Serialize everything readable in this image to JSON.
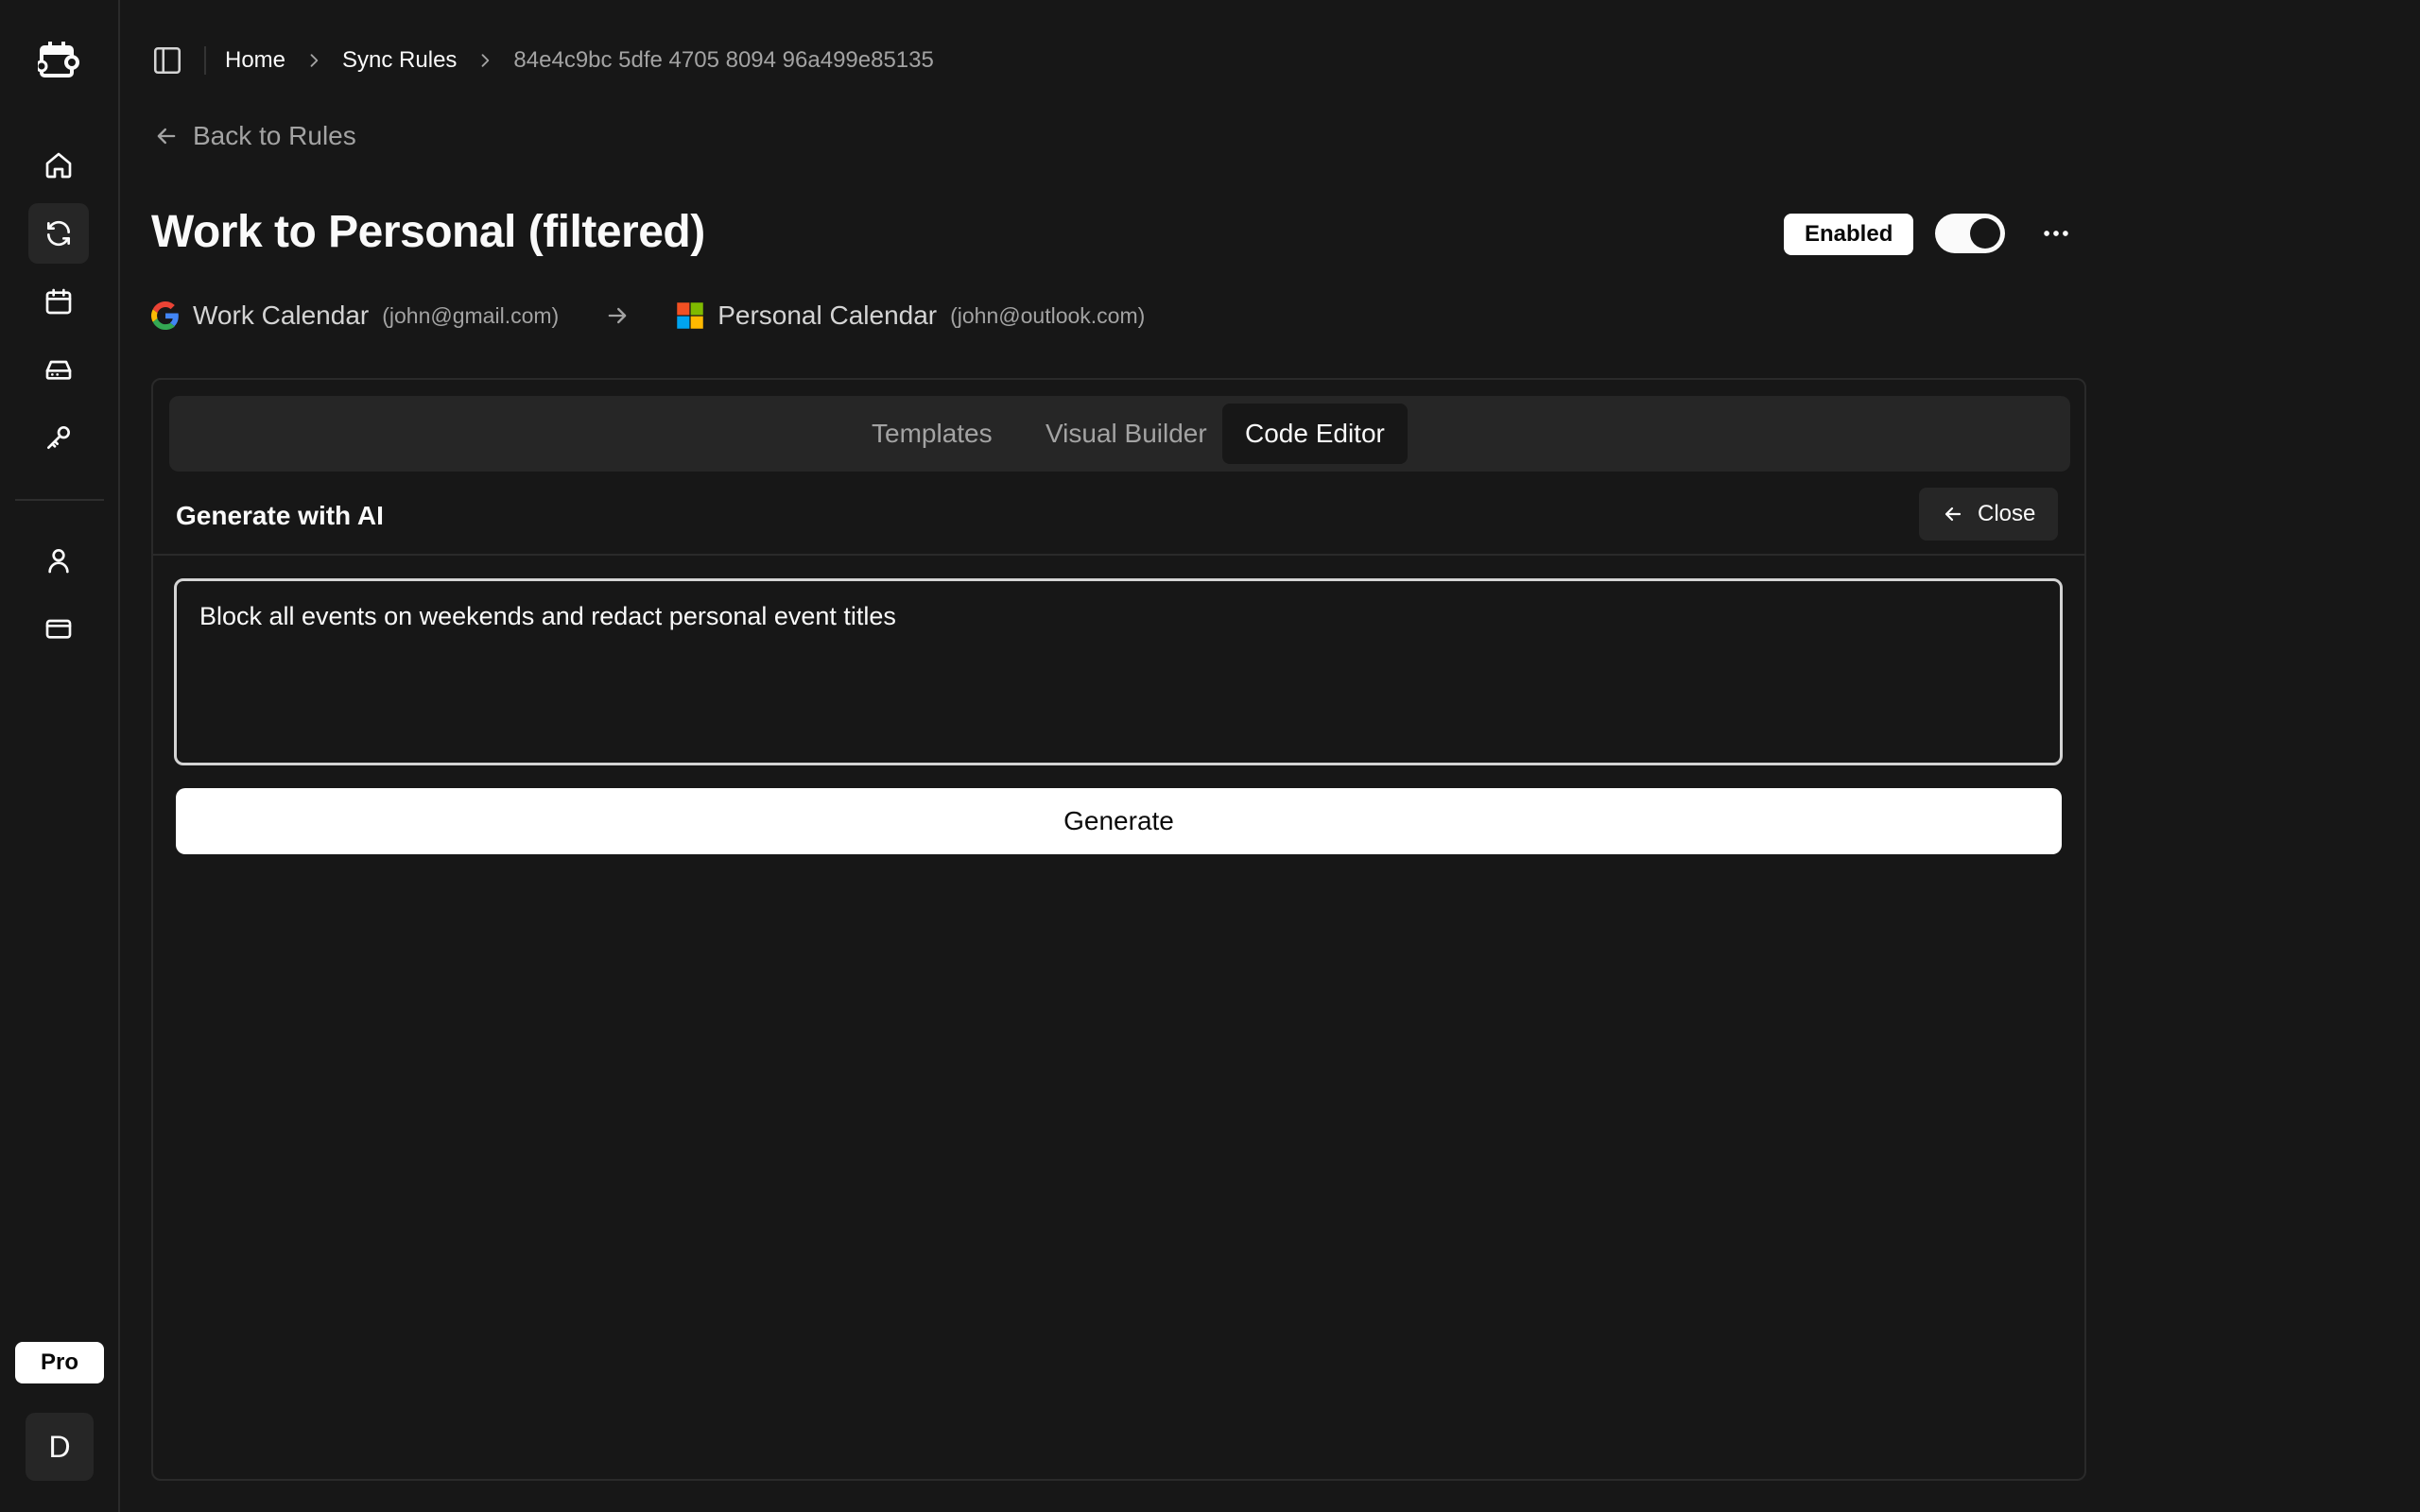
{
  "app": {
    "user_initial": "D",
    "plan_badge": "Pro"
  },
  "sidebar": {
    "items": [
      {
        "name": "home-icon"
      },
      {
        "name": "sync-icon",
        "active": true
      },
      {
        "name": "calendar-icon"
      },
      {
        "name": "drive-icon"
      },
      {
        "name": "key-icon"
      },
      {
        "name": "user-icon"
      },
      {
        "name": "credit-card-icon"
      }
    ]
  },
  "breadcrumb": {
    "items": [
      "Home",
      "Sync Rules",
      "84e4c9bc 5dfe 4705 8094 96a499e85135"
    ]
  },
  "back_link": "Back to Rules",
  "rule": {
    "title": "Work to Personal (filtered)",
    "status": "Enabled",
    "enabled": true,
    "source": {
      "name": "Work Calendar",
      "email": "(john@gmail.com)",
      "provider": "google-icon"
    },
    "destination": {
      "name": "Personal Calendar",
      "email": "(john@outlook.com)",
      "provider": "microsoft-icon"
    }
  },
  "tabs": [
    {
      "label": "Templates"
    },
    {
      "label": "Visual Builder"
    },
    {
      "label": "Code Editor",
      "active": true
    }
  ],
  "ai": {
    "title": "Generate with AI",
    "close_label": "Close",
    "prompt_value": "Block all events on weekends and redact personal event titles",
    "generate_label": "Generate"
  }
}
